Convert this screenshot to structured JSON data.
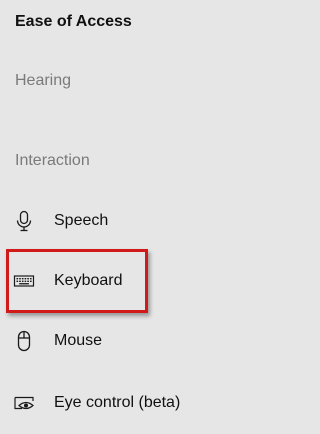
{
  "page": {
    "title": "Ease of Access"
  },
  "sections": [
    {
      "header": "Hearing"
    },
    {
      "header": "Interaction"
    }
  ],
  "nav": {
    "items": [
      {
        "label": "Speech",
        "icon": "microphone-icon"
      },
      {
        "label": "Keyboard",
        "icon": "keyboard-icon",
        "highlighted": true
      },
      {
        "label": "Mouse",
        "icon": "mouse-icon"
      },
      {
        "label": "Eye control (beta)",
        "icon": "eye-control-icon"
      }
    ]
  },
  "colors": {
    "background": "#e6e6e6",
    "text": "#111111",
    "section_header": "#7a7a7a",
    "highlight_border": "#d11a1a"
  }
}
